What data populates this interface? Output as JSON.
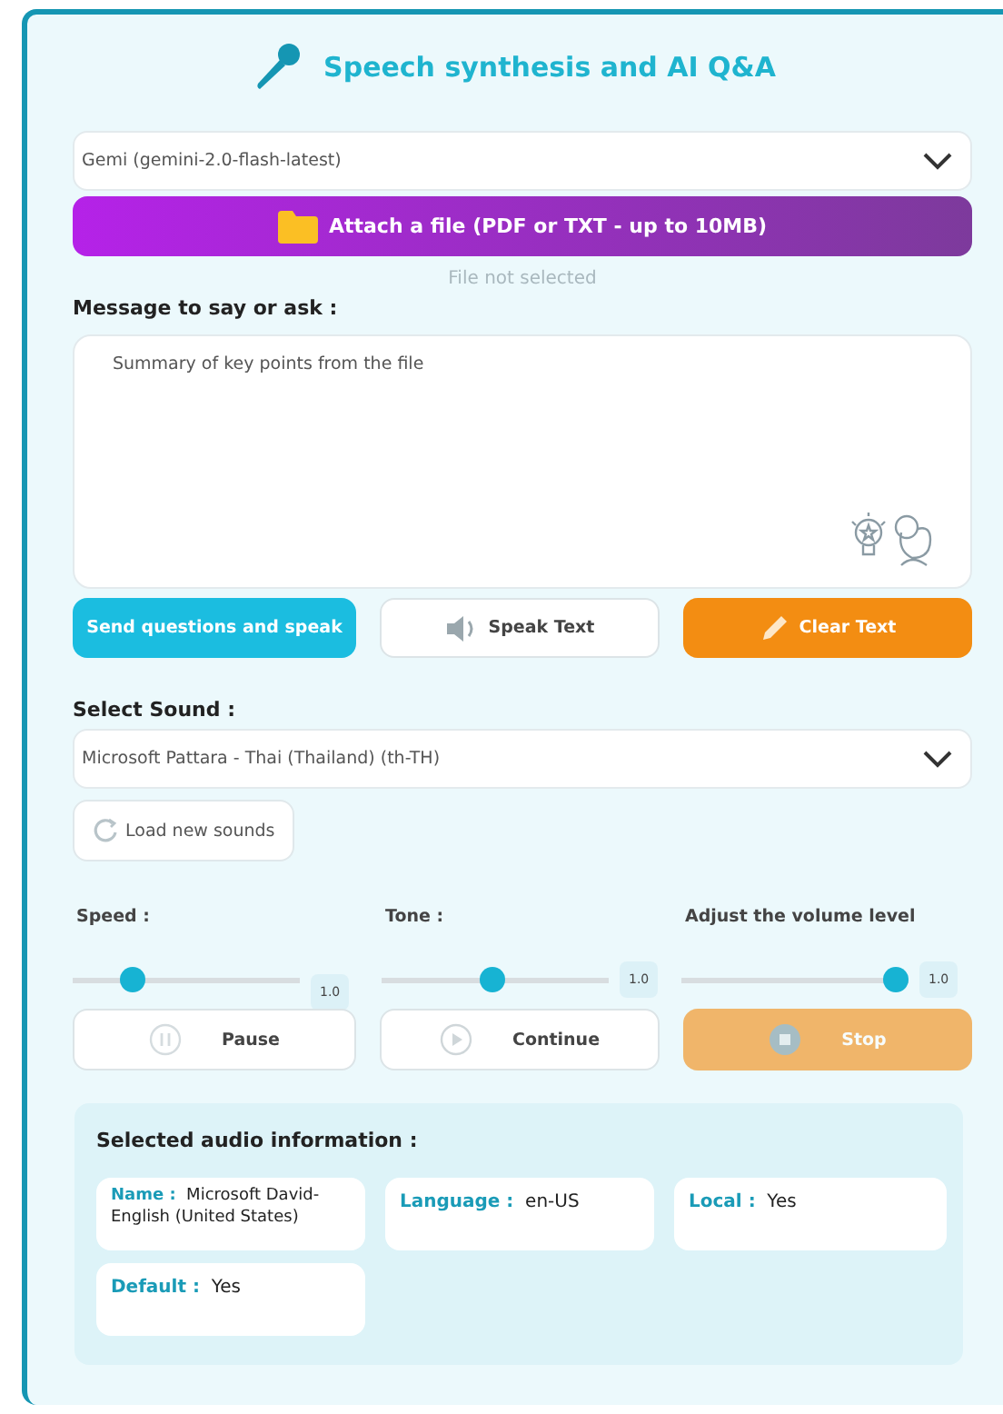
{
  "title": "Speech synthesis and AI Q&A",
  "model_select": {
    "value": "Gemi (gemini-2.0-flash-latest)"
  },
  "attach_button": {
    "label": "Attach a file (PDF or TXT - up to 10MB)"
  },
  "file_status": "File not selected",
  "message": {
    "label": "Message to say or ask :",
    "value": "Summary of key points from the file"
  },
  "actions": [
    {
      "kind": "send",
      "label": "Send questions and speak"
    },
    {
      "kind": "speak",
      "label": "Speak Text"
    },
    {
      "kind": "clear",
      "label": "Clear Text"
    }
  ],
  "sound": {
    "label": "Select Sound :",
    "value": "Microsoft Pattara - Thai (Thailand) (th-TH)",
    "reload_label": "Load new sounds"
  },
  "sliders": [
    {
      "label": "Speed :",
      "level": 0.26,
      "reading": "1.0"
    },
    {
      "label": "Tone :",
      "level": 0.49,
      "reading": "1.0"
    },
    {
      "label": "Adjust the volume level",
      "level": 0.94,
      "reading": "1.0"
    }
  ],
  "playback": [
    {
      "kind": "pause",
      "label": "Pause",
      "disabled": false
    },
    {
      "kind": "continue",
      "label": "Continue",
      "disabled": false
    },
    {
      "kind": "stop",
      "label": "Stop",
      "disabled": true
    }
  ],
  "info": {
    "title": "Selected audio information :",
    "items": [
      {
        "key": "Name :",
        "value": "Microsoft David-English (United States)"
      },
      {
        "key": "Language :",
        "value": "en-US"
      },
      {
        "key": "Local :",
        "value": "Yes"
      },
      {
        "key": "Default :",
        "value": "Yes"
      }
    ]
  }
}
